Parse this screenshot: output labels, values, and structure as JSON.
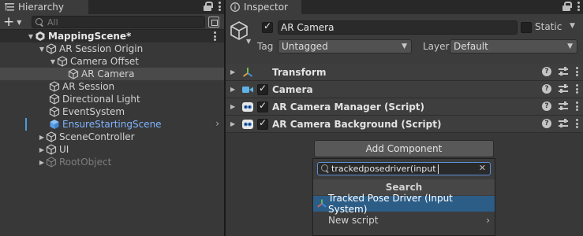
{
  "hierarchy": {
    "tab_title": "Hierarchy",
    "add_glyph": "+",
    "search_placeholder": "All",
    "items": [
      {
        "label": "MappingScene*",
        "kind": "scene"
      },
      {
        "label": "AR Session Origin"
      },
      {
        "label": "Camera Offset"
      },
      {
        "label": "AR Camera",
        "selected": true
      },
      {
        "label": "AR Session"
      },
      {
        "label": "Directional Light"
      },
      {
        "label": "EventSystem"
      },
      {
        "label": "EnsureStartingScene",
        "kind": "prefab"
      },
      {
        "label": "SceneController"
      },
      {
        "label": "UI"
      },
      {
        "label": "RootObject",
        "disabled": true
      }
    ]
  },
  "inspector": {
    "tab_title": "Inspector",
    "object_name": "AR Camera",
    "active": true,
    "static_label": "Static",
    "static": false,
    "tag_label": "Tag",
    "tag_value": "Untagged",
    "layer_label": "Layer",
    "layer_value": "Default",
    "components": [
      {
        "title": "Transform",
        "icon": "transform-icon",
        "has_toggle": false
      },
      {
        "title": "Camera",
        "icon": "camera-icon",
        "has_toggle": true
      },
      {
        "title": "AR Camera Manager (Script)",
        "icon": "script-icon",
        "has_toggle": true
      },
      {
        "title": "AR Camera Background (Script)",
        "icon": "script-icon",
        "has_toggle": true
      }
    ],
    "add_component_label": "Add Component",
    "popup": {
      "search_value": "trackedposedriver(input",
      "header": "Search",
      "items": [
        {
          "label": "Tracked Pose Driver (Input System)",
          "selected": true
        },
        {
          "label": "New script"
        }
      ]
    }
  },
  "colors": {
    "panel_bg": "#383838",
    "selection_blue": "#2c5d87",
    "prefab_text": "#7fb4ff",
    "accent_outline": "#5b8fd6"
  }
}
